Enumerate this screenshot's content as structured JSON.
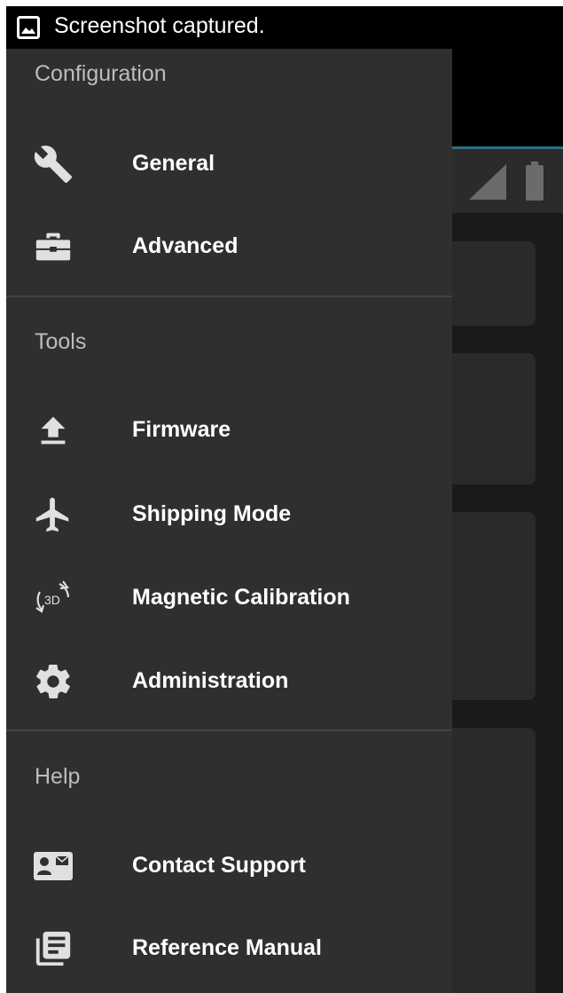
{
  "status_bar": {
    "notification_text": "Screenshot captured.",
    "notification_icon": "image-icon"
  },
  "colors": {
    "drawer_background": "#2f2f2f",
    "status_bar": "#000000",
    "accent_line": "#2a6f82",
    "text_primary": "#ffffff",
    "text_section": "#bdbdbd",
    "icon": "#e0e0e0"
  },
  "drawer": {
    "sections": [
      {
        "header": "Configuration",
        "items": [
          {
            "label": "General",
            "icon": "wrench-icon"
          },
          {
            "label": "Advanced",
            "icon": "toolbox-icon"
          }
        ]
      },
      {
        "header": "Tools",
        "items": [
          {
            "label": "Firmware",
            "icon": "upload-icon"
          },
          {
            "label": "Shipping Mode",
            "icon": "airplane-icon"
          },
          {
            "label": "Magnetic Calibration",
            "icon": "rotate-3d-icon"
          },
          {
            "label": "Administration",
            "icon": "gear-icon"
          }
        ]
      },
      {
        "header": "Help",
        "items": [
          {
            "label": "Contact Support",
            "icon": "contact-card-icon"
          },
          {
            "label": "Reference Manual",
            "icon": "library-books-icon"
          }
        ]
      }
    ]
  },
  "icons": {
    "rotate_3d_text": "3D"
  }
}
